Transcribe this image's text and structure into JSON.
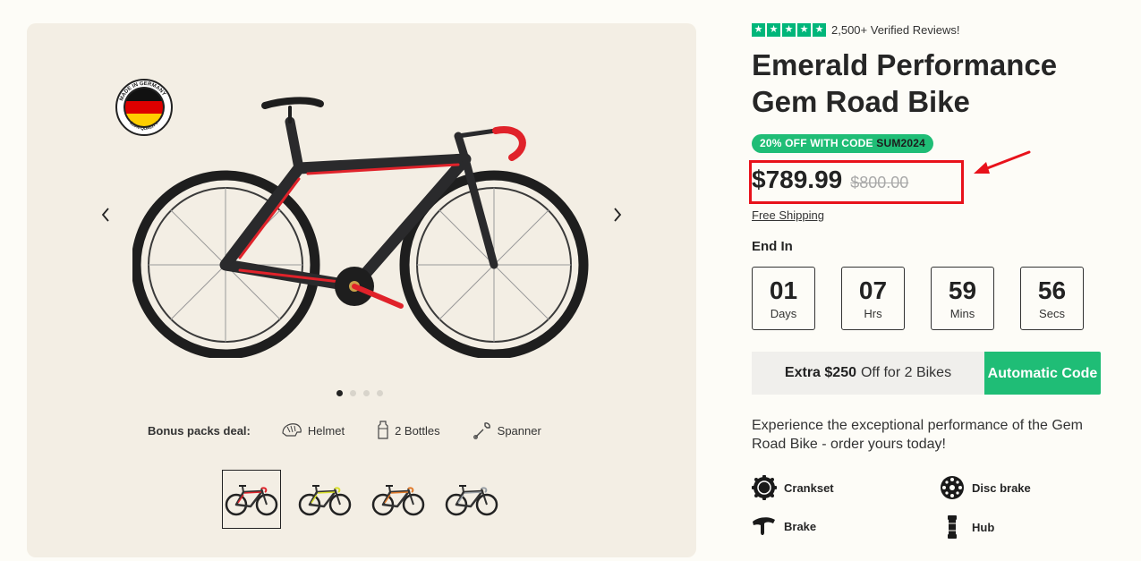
{
  "gallery": {
    "badge_text": "MADE IN GERMANY · 100% QUALITY",
    "dots": 4,
    "active_dot": 0,
    "bonus": {
      "label": "Bonus packs deal:",
      "items": [
        {
          "icon": "helmet-icon",
          "label": "Helmet"
        },
        {
          "icon": "bottle-icon",
          "label": "2 Bottles"
        },
        {
          "icon": "spanner-icon",
          "label": "Spanner"
        }
      ]
    },
    "thumbnail_accents": [
      "#e0222a",
      "#d9e02a",
      "#e07a2a",
      "#9aa0a6"
    ]
  },
  "product": {
    "reviews": "2,500+ Verified Reviews!",
    "rating_stars": 5,
    "title": "Emerald Performance Gem Road Bike",
    "promo_text": "20% OFF WITH CODE ",
    "promo_code": "SUM2024",
    "price": "$789.99",
    "compare_price": "$800.00",
    "shipping": "Free Shipping",
    "countdown_label": "End In",
    "countdown": [
      {
        "value": "01",
        "unit": "Days"
      },
      {
        "value": "07",
        "unit": "Hrs"
      },
      {
        "value": "59",
        "unit": "Mins"
      },
      {
        "value": "56",
        "unit": "Secs"
      }
    ],
    "offer": {
      "highlight": "Extra $250",
      "text": "Off for 2 Bikes",
      "button": "Automatic Code"
    },
    "description": "Experience the exceptional performance of the Gem Road Bike - order yours today!",
    "features": [
      {
        "icon": "crankset-icon",
        "label": "Crankset"
      },
      {
        "icon": "disc-brake-icon",
        "label": "Disc brake"
      },
      {
        "icon": "brake-icon",
        "label": "Brake"
      },
      {
        "icon": "hub-icon",
        "label": "Hub"
      }
    ]
  },
  "colors": {
    "accent_green": "#1fbd76",
    "trustpilot_green": "#00b67a",
    "highlight_red": "#e8121b",
    "gallery_bg": "#f3eee4"
  }
}
